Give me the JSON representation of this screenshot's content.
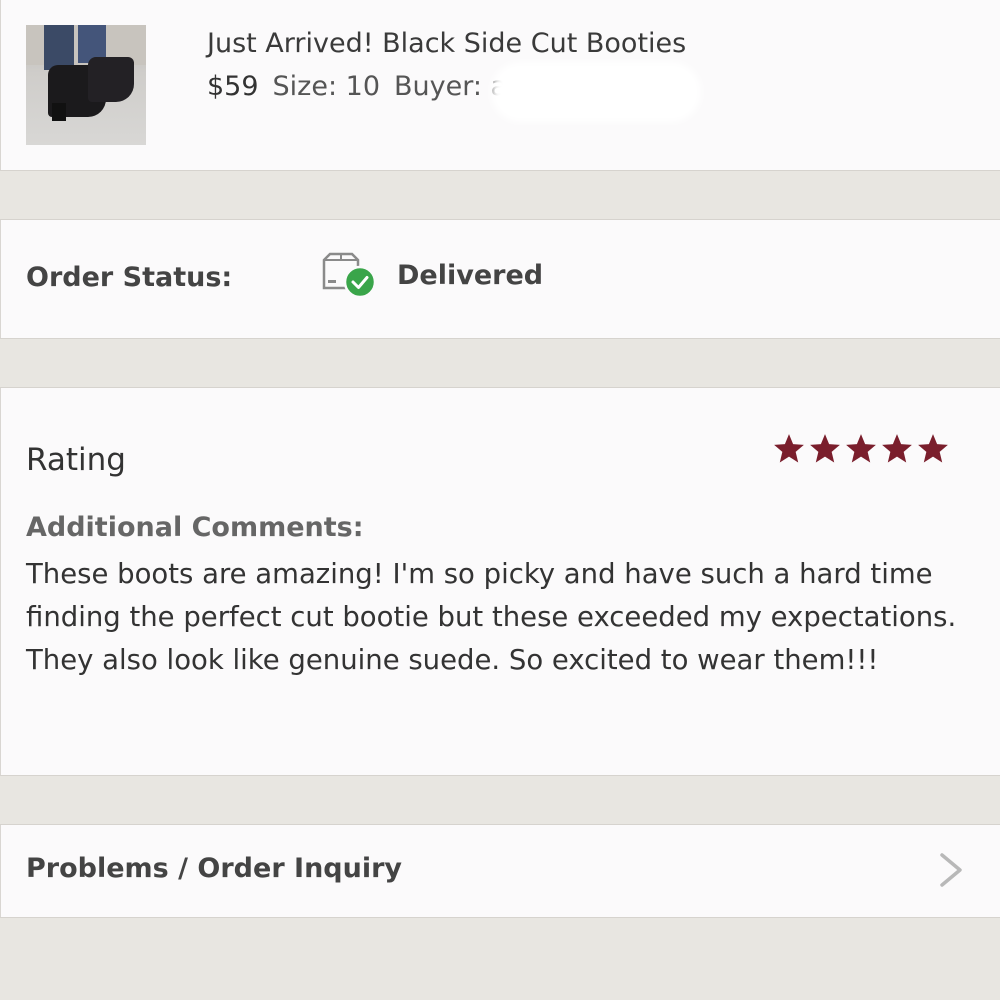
{
  "item": {
    "title": "Just Arrived! Black Side Cut Booties",
    "price": "$59",
    "size": "Size: 10",
    "buyer_label": "Buyer: a"
  },
  "order_status": {
    "label": "Order Status:",
    "value": "Delivered",
    "icon": "box-delivered-check-icon"
  },
  "rating": {
    "label": "Rating",
    "stars": 5,
    "max_stars": 5,
    "star_color": "#7a1e2c",
    "comments_label": "Additional Comments:",
    "comments": "These boots are amazing! I'm so picky and have such a hard time finding the perfect cut bootie but these exceeded my expectations. They also look like genuine suede. So excited to wear them!!!"
  },
  "problems": {
    "label": "Problems / Order Inquiry",
    "icon": "chevron-right-icon"
  },
  "colors": {
    "check_green": "#3aa54a",
    "background": "#e8e6e1",
    "panel": "#fbfafb"
  }
}
